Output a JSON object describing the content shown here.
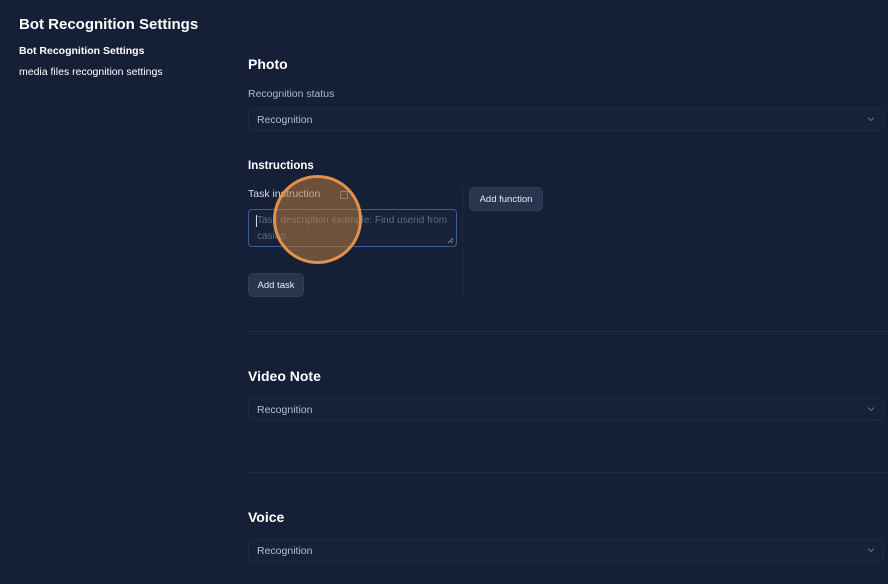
{
  "sidebar": {
    "title": "Bot Recognition Settings",
    "items": [
      {
        "label": "Bot Recognition Settings"
      },
      {
        "label": "media files recognition settings"
      }
    ]
  },
  "photo": {
    "title": "Photo",
    "status_label": "Recognition status",
    "status_value": "Recognition",
    "instructions_title": "Instructions",
    "task_label": "Task instruction",
    "task_placeholder": "Task description example: Find userid from casino",
    "add_function_label": "Add function",
    "add_task_label": "Add task"
  },
  "video_note": {
    "title": "Video Note",
    "status_value": "Recognition"
  },
  "voice": {
    "title": "Voice",
    "status_value": "Recognition"
  }
}
